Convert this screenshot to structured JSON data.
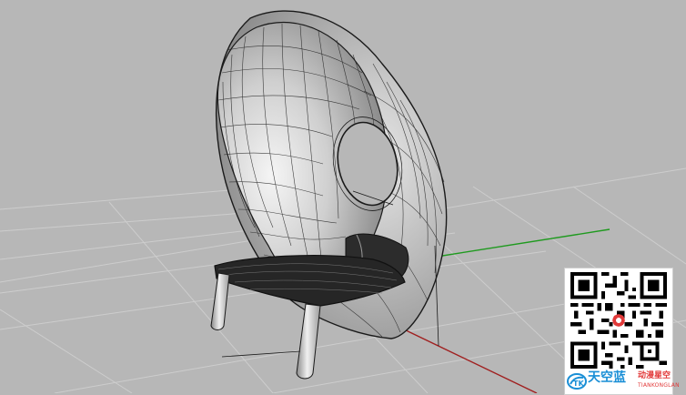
{
  "viewport": {
    "background": "#b7b7b7",
    "grid_color": "#cdcdcd",
    "x_axis_color": "#a01f1f",
    "y_axis_color": "#1f9a1f",
    "model_color": "#1a1a1a",
    "shade_light": "#f2f2f2",
    "shade_dark": "#8a8a8a"
  },
  "watermark": {
    "brand_name": "天空蓝",
    "tagline": "动漫星空",
    "pinyin": "TIANKONGLAN",
    "brand_color": "#1a8fd6",
    "accent_color": "#e23a3a"
  },
  "icons": {
    "qr": "qr-code",
    "logo": "brand-logo-icon"
  }
}
